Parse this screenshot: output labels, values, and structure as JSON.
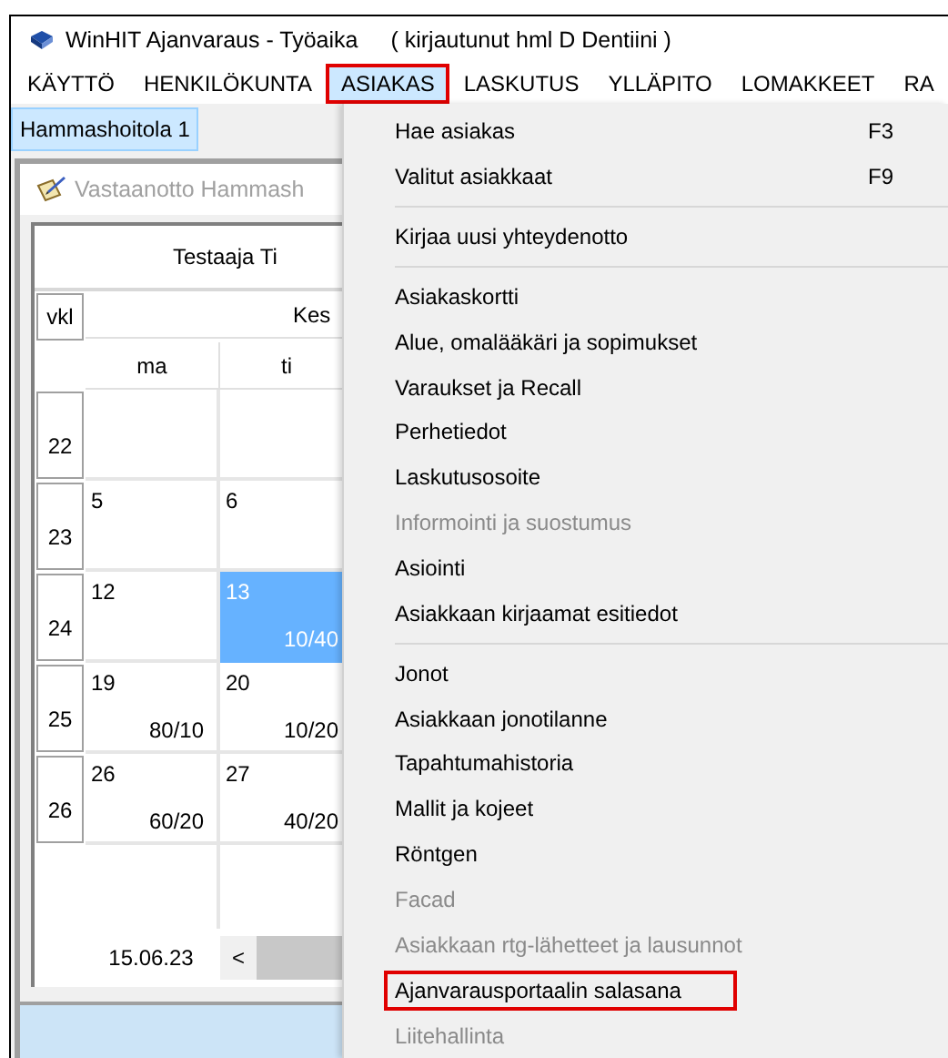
{
  "window": {
    "title": "WinHIT Ajanvaraus - Työaika",
    "subtitle": "( kirjautunut hml D Dentiini )"
  },
  "menu_bar": [
    {
      "label": "KÄYTTÖ",
      "open": false,
      "highlighted": false
    },
    {
      "label": "HENKILÖKUNTA",
      "open": false,
      "highlighted": false
    },
    {
      "label": "ASIAKAS",
      "open": true,
      "highlighted": true
    },
    {
      "label": "LASKUTUS",
      "open": false,
      "highlighted": false
    },
    {
      "label": "YLLÄPITO",
      "open": false,
      "highlighted": false
    },
    {
      "label": "LOMAKKEET",
      "open": false,
      "highlighted": false
    },
    {
      "label": "RA",
      "open": false,
      "highlighted": false
    }
  ],
  "tabs": [
    {
      "label": "Hammashoitola 1",
      "selected": true
    }
  ],
  "calendar_window": {
    "title": "Vastaanotto Hammash",
    "heading": "Testaaja Ti",
    "week_header": "vkl",
    "month": "Kes",
    "days": [
      "ma",
      "ti"
    ],
    "weeks": [
      {
        "week": "22",
        "cells": [
          {
            "selected": false
          },
          {
            "selected": false
          }
        ]
      },
      {
        "week": "23",
        "cells": [
          {
            "day": "5",
            "selected": false
          },
          {
            "day": "6",
            "selected": false
          }
        ]
      },
      {
        "week": "24",
        "cells": [
          {
            "day": "12",
            "selected": false
          },
          {
            "day": "13",
            "value": "10/40",
            "selected": true
          }
        ]
      },
      {
        "week": "25",
        "cells": [
          {
            "day": "19",
            "value": "80/10",
            "selected": false
          },
          {
            "day": "20",
            "value": "10/20",
            "selected": false
          }
        ]
      },
      {
        "week": "26",
        "cells": [
          {
            "day": "26",
            "value": "60/20",
            "selected": false
          },
          {
            "day": "27",
            "value": "40/20",
            "selected": false
          }
        ]
      }
    ],
    "date_field": {
      "value": "15.06.23"
    },
    "scroll_left": "<"
  },
  "menu": {
    "items": [
      {
        "kind": "item",
        "label": "Hae asiakas",
        "shortcut": "F3",
        "disabled": false,
        "highlighted": false
      },
      {
        "kind": "item",
        "label": "Valitut asiakkaat",
        "shortcut": "F9",
        "disabled": false,
        "highlighted": false
      },
      {
        "kind": "separator"
      },
      {
        "kind": "item",
        "label": "Kirjaa uusi yhteydenotto",
        "disabled": false,
        "highlighted": false
      },
      {
        "kind": "separator"
      },
      {
        "kind": "item",
        "label": "Asiakaskortti",
        "disabled": false,
        "highlighted": false
      },
      {
        "kind": "item",
        "label": "Alue, omalääkäri ja sopimukset",
        "disabled": false,
        "highlighted": false
      },
      {
        "kind": "item",
        "label": "Varaukset ja Recall",
        "disabled": false,
        "highlighted": false
      },
      {
        "kind": "item",
        "label": "Perhetiedot",
        "disabled": false,
        "highlighted": false
      },
      {
        "kind": "item",
        "label": "Laskutusosoite",
        "disabled": false,
        "highlighted": false
      },
      {
        "kind": "item",
        "label": "Informointi ja suostumus",
        "disabled": true,
        "highlighted": false
      },
      {
        "kind": "item",
        "label": "Asiointi",
        "disabled": false,
        "highlighted": false
      },
      {
        "kind": "item",
        "label": "Asiakkaan kirjaamat esitiedot",
        "disabled": false,
        "highlighted": false
      },
      {
        "kind": "separator"
      },
      {
        "kind": "item",
        "label": "Jonot",
        "disabled": false,
        "highlighted": false
      },
      {
        "kind": "item",
        "label": "Asiakkaan jonotilanne",
        "disabled": false,
        "highlighted": false
      },
      {
        "kind": "item",
        "label": "Tapahtumahistoria",
        "disabled": false,
        "highlighted": false
      },
      {
        "kind": "item",
        "label": "Mallit ja kojeet",
        "disabled": false,
        "highlighted": false
      },
      {
        "kind": "item",
        "label": "Röntgen",
        "disabled": false,
        "highlighted": false
      },
      {
        "kind": "item",
        "label": "Facad",
        "disabled": true,
        "highlighted": false
      },
      {
        "kind": "item",
        "label": "Asiakkaan rtg-lähetteet ja lausunnot",
        "disabled": true,
        "highlighted": false
      },
      {
        "kind": "item",
        "label": "Ajanvarausportaalin salasana",
        "disabled": false,
        "highlighted": true
      },
      {
        "kind": "item",
        "label": "Liitehallinta",
        "disabled": true,
        "highlighted": false
      }
    ]
  }
}
